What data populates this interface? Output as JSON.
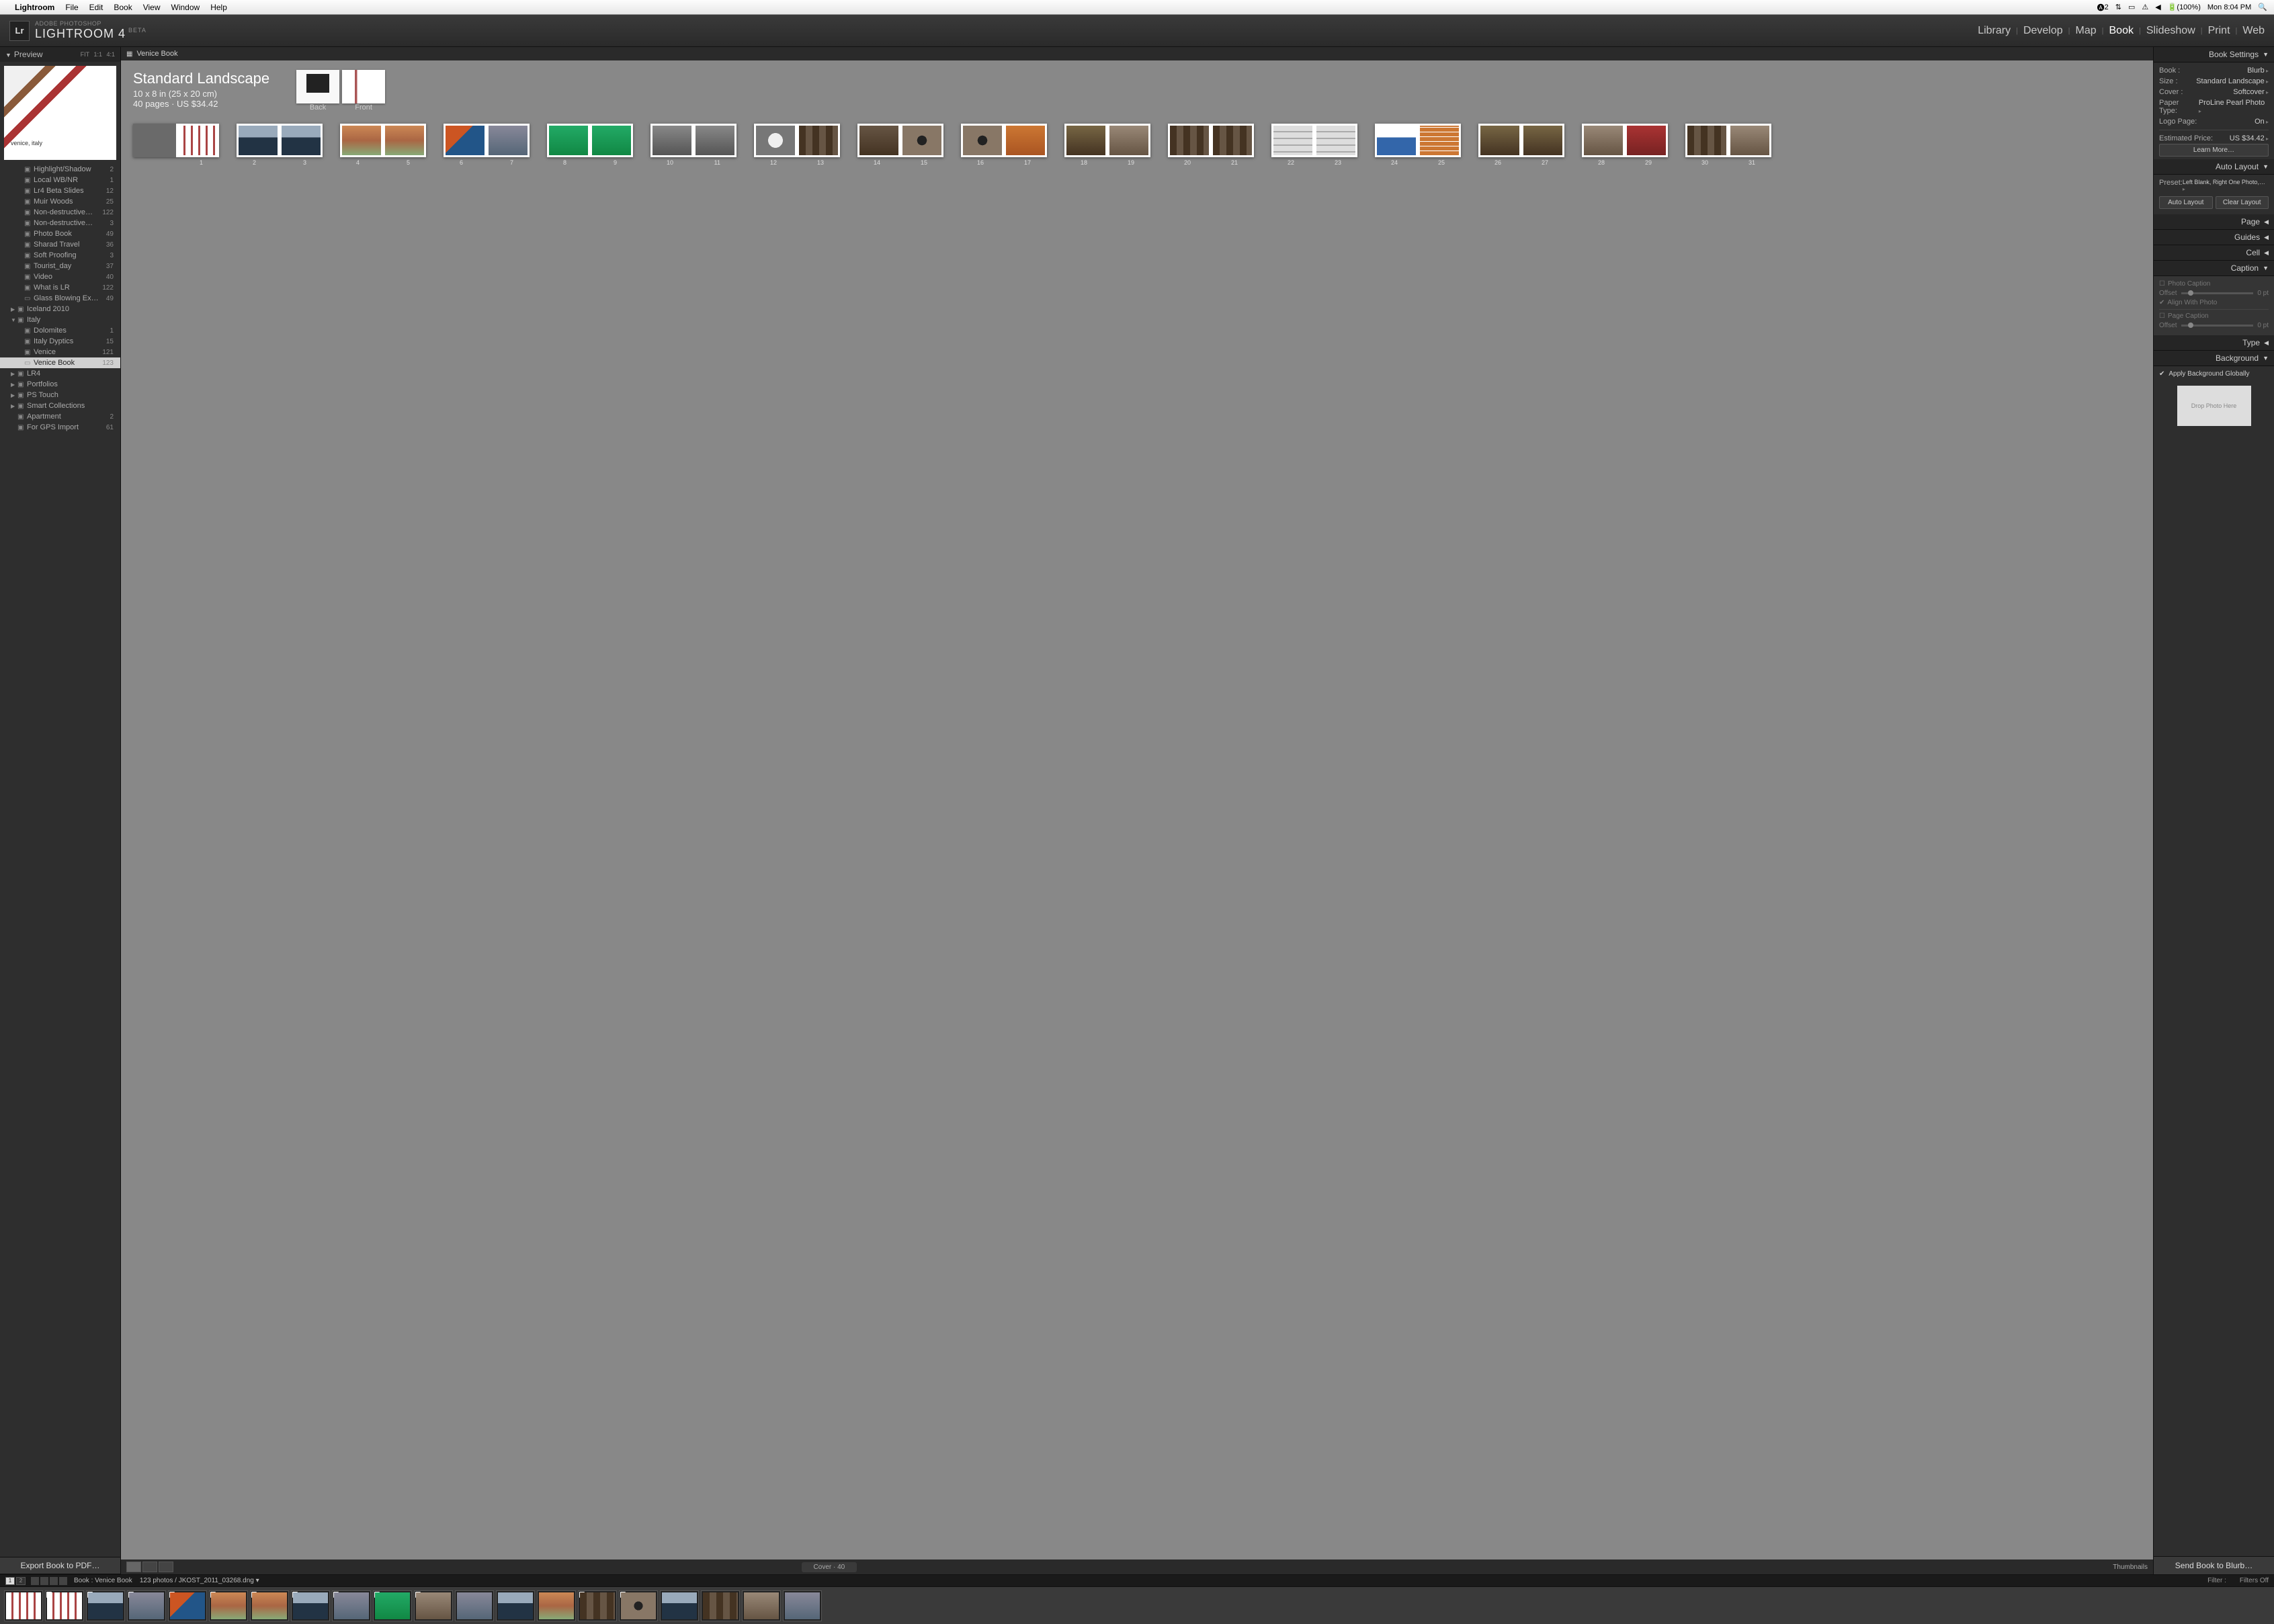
{
  "menubar": {
    "app": "Lightroom",
    "items": [
      "File",
      "Edit",
      "Book",
      "View",
      "Window",
      "Help"
    ],
    "status": {
      "users": "2",
      "battery": "(100%)",
      "clock": "Mon 8:04 PM"
    }
  },
  "header": {
    "brand_sub": "ADOBE PHOTOSHOP",
    "brand_main": "LIGHTROOM 4",
    "brand_beta": "BETA",
    "logo": "Lr",
    "modules": [
      "Library",
      "Develop",
      "Map",
      "Book",
      "Slideshow",
      "Print",
      "Web"
    ],
    "active_module": "Book"
  },
  "left": {
    "preview_label": "Preview",
    "zoom": {
      "fit": "FIT",
      "one": "1:1",
      "four": "4:1"
    },
    "preview_caption": "venice, italy",
    "collections": [
      {
        "name": "Highlight/Shadow",
        "count": 2,
        "indent": 2
      },
      {
        "name": "Local WB/NR",
        "count": 1,
        "indent": 2
      },
      {
        "name": "Lr4 Beta Slides",
        "count": 12,
        "indent": 2
      },
      {
        "name": "Muir Woods",
        "count": 25,
        "indent": 2
      },
      {
        "name": "Non-destructive…",
        "count": 122,
        "indent": 2
      },
      {
        "name": "Non-destructive…",
        "count": 3,
        "indent": 2
      },
      {
        "name": "Photo Book",
        "count": 49,
        "indent": 2
      },
      {
        "name": "Sharad Travel",
        "count": 36,
        "indent": 2
      },
      {
        "name": "Soft Proofing",
        "count": 3,
        "indent": 2
      },
      {
        "name": "Tourist_day",
        "count": 37,
        "indent": 2
      },
      {
        "name": "Video",
        "count": 40,
        "indent": 2
      },
      {
        "name": "What is LR",
        "count": 122,
        "indent": 2
      },
      {
        "name": "Glass Blowing Ex…",
        "count": 49,
        "indent": 2,
        "book": true
      },
      {
        "name": "Iceland 2010",
        "count": "",
        "indent": 1,
        "arrow": "▶"
      },
      {
        "name": "Italy",
        "count": "",
        "indent": 1,
        "arrow": "▼"
      },
      {
        "name": "Dolomites",
        "count": 1,
        "indent": 2
      },
      {
        "name": "Italy Dyptics",
        "count": 15,
        "indent": 2
      },
      {
        "name": "Venice",
        "count": 121,
        "indent": 2
      },
      {
        "name": "Venice Book",
        "count": 123,
        "indent": 2,
        "book": true,
        "selected": true
      },
      {
        "name": "LR4",
        "count": "",
        "indent": 1,
        "arrow": "▶"
      },
      {
        "name": "Portfolios",
        "count": "",
        "indent": 1,
        "arrow": "▶"
      },
      {
        "name": "PS Touch",
        "count": "",
        "indent": 1,
        "arrow": "▶"
      },
      {
        "name": "Smart Collections",
        "count": "",
        "indent": 1,
        "arrow": "▶"
      },
      {
        "name": "Apartment",
        "count": 2,
        "indent": 1
      },
      {
        "name": "For GPS Import",
        "count": 61,
        "indent": 1
      }
    ],
    "export_label": "Export Book to PDF…"
  },
  "center": {
    "title": "Venice Book",
    "book": {
      "title": "Standard Landscape",
      "dimensions": "10 x 8 in (25 x 20 cm)",
      "pages_price": "40 pages · US $34.42",
      "back_label": "Back",
      "front_label": "Front"
    },
    "spreads": [
      {
        "l": "",
        "r": "1",
        "lfill": "blank",
        "rfill": "stripes"
      },
      {
        "l": "2",
        "r": "3",
        "lfill": "gondola",
        "rfill": "gondola"
      },
      {
        "l": "4",
        "r": "5",
        "lfill": "buildings",
        "rfill": "buildings"
      },
      {
        "l": "6",
        "r": "7",
        "lfill": "boat",
        "rfill": "canal"
      },
      {
        "l": "8",
        "r": "9",
        "lfill": "green",
        "rfill": "green"
      },
      {
        "l": "10",
        "r": "11",
        "lfill": "sculpt",
        "rfill": "sculpt"
      },
      {
        "l": "12",
        "r": "13",
        "lfill": "mask",
        "rfill": "doors"
      },
      {
        "l": "14",
        "r": "15",
        "lfill": "lion",
        "rfill": "knocker"
      },
      {
        "l": "16",
        "r": "17",
        "lfill": "knocker",
        "rfill": "pizza"
      },
      {
        "l": "18",
        "r": "19",
        "lfill": "rust",
        "rfill": "window"
      },
      {
        "l": "20",
        "r": "21",
        "lfill": "doors",
        "rfill": "doors"
      },
      {
        "l": "22",
        "r": "23",
        "lfill": "arches",
        "rfill": "arches"
      },
      {
        "l": "24",
        "r": "25",
        "lfill": "blue",
        "rfill": "tiles"
      },
      {
        "l": "26",
        "r": "27",
        "lfill": "rust",
        "rfill": "rust"
      },
      {
        "l": "28",
        "r": "29",
        "lfill": "window",
        "rfill": "red"
      },
      {
        "l": "30",
        "r": "31",
        "lfill": "doors",
        "rfill": "window"
      }
    ],
    "bottom": {
      "cover_label": "Cover · 40",
      "thumbs_label": "Thumbnails"
    }
  },
  "right": {
    "book_settings": {
      "header": "Book Settings",
      "book": {
        "label": "Book :",
        "val": "Blurb"
      },
      "size": {
        "label": "Size :",
        "val": "Standard Landscape"
      },
      "cover": {
        "label": "Cover :",
        "val": "Softcover"
      },
      "paper": {
        "label": "Paper Type:",
        "val": "ProLine Pearl Photo"
      },
      "logo": {
        "label": "Logo Page:",
        "val": "On"
      },
      "price": {
        "label": "Estimated Price:",
        "val": "US $34.42"
      },
      "learn": "Learn More…"
    },
    "auto_layout": {
      "header": "Auto Layout",
      "preset": {
        "label": "Preset:",
        "val": "Left Blank, Right One Photo,…"
      },
      "auto_btn": "Auto Layout",
      "clear_btn": "Clear Layout"
    },
    "page_header": "Page",
    "guides_header": "Guides",
    "cell_header": "Cell",
    "caption": {
      "header": "Caption",
      "photo_caption": "Photo Caption",
      "offset": "Offset",
      "offset_val": "0 pt",
      "align": "Align With Photo",
      "page_caption": "Page Caption"
    },
    "type_header": "Type",
    "background": {
      "header": "Background",
      "apply": "Apply Background Globally",
      "drop": "Drop Photo Here"
    },
    "send_label": "Send Book to Blurb…"
  },
  "filmstrip": {
    "breadcrumb_book": "Book : Venice Book",
    "count": "123 photos",
    "filename": "JKOST_2011_03268.dng",
    "filter_label": "Filter :",
    "filters_off": "Filters Off",
    "thumbs": [
      {
        "fill": "stripes",
        "badge": ""
      },
      {
        "fill": "stripes",
        "badge": "1"
      },
      {
        "fill": "gondola",
        "badge": "1"
      },
      {
        "fill": "canal",
        "badge": "1"
      },
      {
        "fill": "boat",
        "badge": "1"
      },
      {
        "fill": "buildings",
        "badge": "1"
      },
      {
        "fill": "buildings",
        "badge": "1"
      },
      {
        "fill": "gondola",
        "badge": "1"
      },
      {
        "fill": "canal",
        "badge": "1"
      },
      {
        "fill": "green",
        "badge": "1"
      },
      {
        "fill": "window",
        "badge": "1"
      },
      {
        "fill": "canal",
        "badge": ""
      },
      {
        "fill": "gondola",
        "badge": ""
      },
      {
        "fill": "buildings",
        "badge": ""
      },
      {
        "fill": "doors",
        "badge": "1"
      },
      {
        "fill": "knocker",
        "badge": "1"
      },
      {
        "fill": "gondola",
        "badge": ""
      },
      {
        "fill": "doors",
        "badge": ""
      },
      {
        "fill": "window",
        "badge": ""
      },
      {
        "fill": "canal",
        "badge": ""
      }
    ]
  }
}
